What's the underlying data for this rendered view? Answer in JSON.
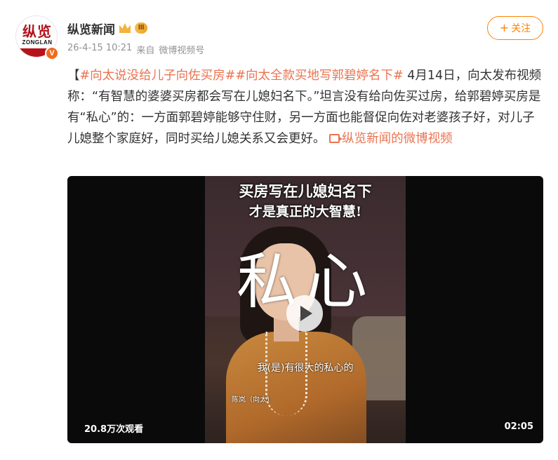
{
  "account": {
    "avatar_logo_cn": "纵览",
    "avatar_logo_en": "ZONGLAN",
    "verified_badge": "V",
    "name": "纵览新闻",
    "level_badge": "III",
    "crown_icon": "crown-icon"
  },
  "meta": {
    "timestamp": "26-4-15 10:21",
    "source_prefix": "来自",
    "source": "微博视频号"
  },
  "follow_button": {
    "plus": "+",
    "label": "关注"
  },
  "post": {
    "bracket_open": "【",
    "tag1": "#向太说没给儿子向佐买房#",
    "tag2": "#向太全款买地写郭碧婷名下#",
    "body": " 4月14日，向太发布视频称：“有智慧的婆婆买房都会写在儿媳妇名下。”坦言没有给向佐买过房，给郭碧婷买房是有“私心”的：一方面郭碧婷能够守住财，另一方面也能督促向佐对老婆孩子好，对儿子儿媳整个家庭好，同时买给儿媳关系又会更好。",
    "link_text": "纵览新闻的微博视频"
  },
  "video": {
    "headline_line1": "买房写在儿媳妇名下",
    "headline_line2": "才是真正的大智慧!",
    "big_word": "私心",
    "subtitle": "我(是)有很大的私心的",
    "speaker_caption": "陈岚（向太）",
    "views": "20.8万次观看",
    "duration": "02:05"
  },
  "colors": {
    "accent": "#ff8200",
    "link": "#eb7350",
    "brand_red": "#b5121b",
    "verified": "#f06b1c"
  }
}
